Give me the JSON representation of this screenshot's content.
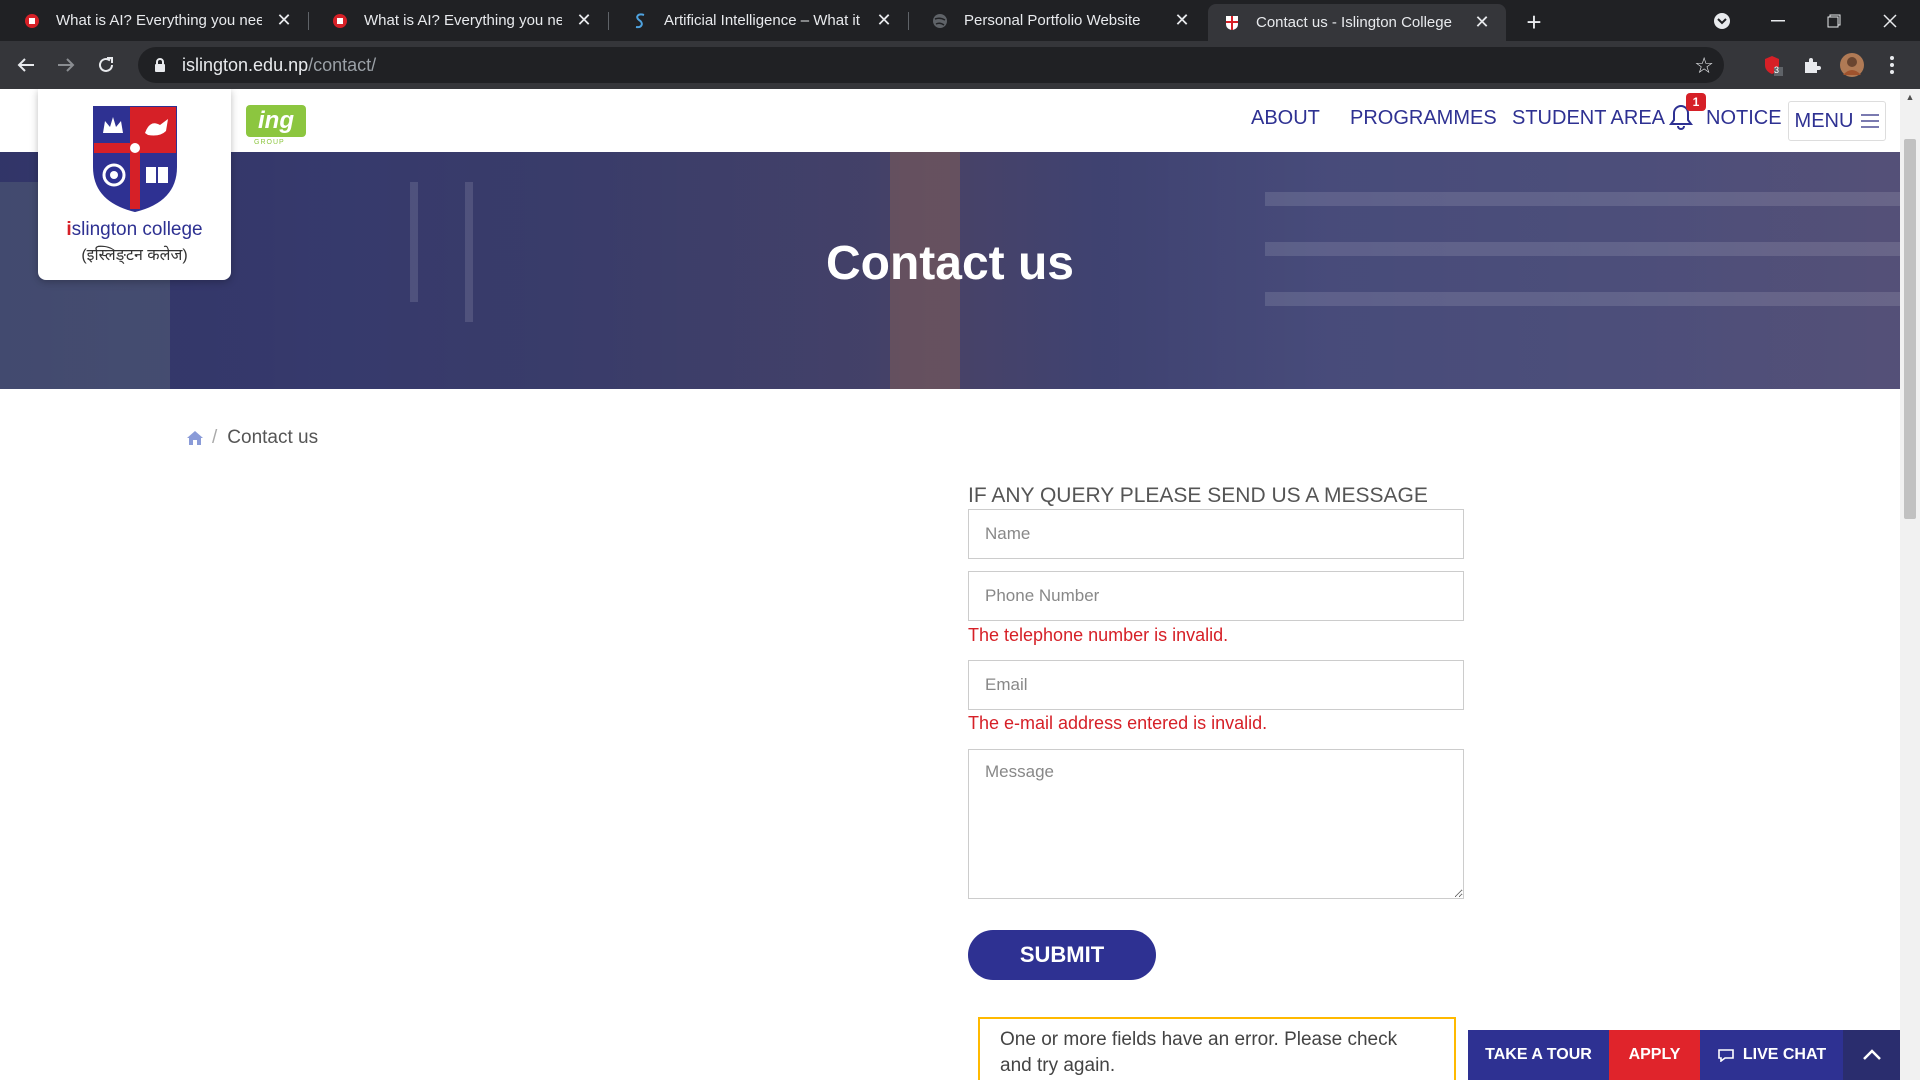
{
  "browser": {
    "tabs": [
      {
        "title": "What is AI? Everything you need",
        "favicon": "red-round-icon"
      },
      {
        "title": "What is AI? Everything you need",
        "favicon": "red-round-icon"
      },
      {
        "title": "Artificial Intelligence – What it is",
        "favicon": "blue-s-icon"
      },
      {
        "title": "Personal Portfolio Website",
        "favicon": "globe-icon"
      },
      {
        "title": "Contact us - Islington College",
        "favicon": "college-crest-icon"
      }
    ],
    "active_tab_index": 4,
    "url_domain": "islington.edu.np",
    "url_path": "/contact/",
    "extension_badge": "3"
  },
  "site": {
    "logo_name_initial": "i",
    "logo_name_rest": "slington college",
    "logo_subtitle": "(इस्लिङ्टन कलेज)",
    "partner_logo": "ing",
    "partner_logo_sub": "GROUP",
    "nav": {
      "about": "ABOUT",
      "programmes": "PROGRAMMES",
      "student_area": "STUDENT AREA",
      "notice": "NOTICE",
      "notice_count": "1",
      "menu": "MENU"
    }
  },
  "hero": {
    "title": "Contact us"
  },
  "breadcrumb": {
    "current": "Contact us"
  },
  "form": {
    "heading": "IF ANY QUERY PLEASE SEND US A MESSAGE",
    "name_placeholder": "Name",
    "phone_placeholder": "Phone Number",
    "phone_error": "The telephone number is invalid.",
    "email_placeholder": "Email",
    "email_error": "The e-mail address entered is invalid.",
    "message_placeholder": "Message",
    "submit_label": "SUBMIT",
    "form_error": "One or more fields have an error. Please check and try again."
  },
  "cta": {
    "tour": "TAKE A TOUR",
    "apply": "APPLY",
    "chat": "LIVE CHAT"
  },
  "colors": {
    "brand_navy": "#2e3192",
    "brand_red": "#d62027",
    "error_red": "#d62027",
    "alert_border": "#ffb900",
    "ing_green": "#8cc63f"
  }
}
